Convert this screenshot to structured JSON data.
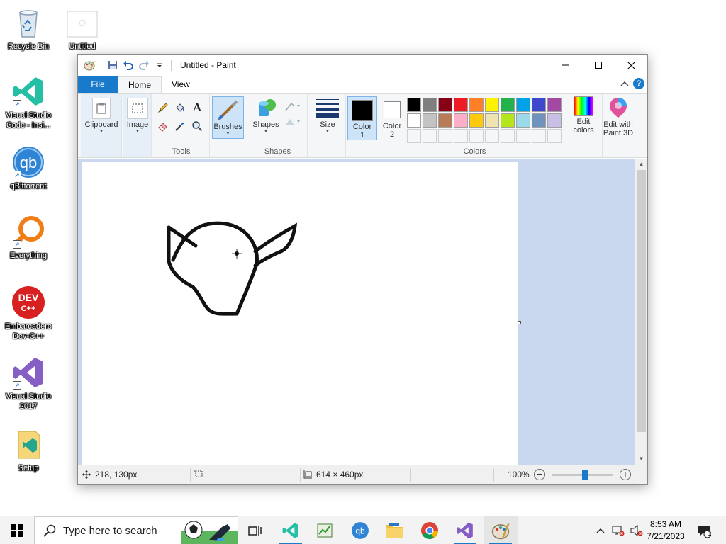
{
  "desktop": {
    "icons": [
      {
        "label": "Recycle Bin",
        "icon": "recycle-bin-icon"
      },
      {
        "label": "Untitled",
        "icon": "paint-file-icon"
      },
      {
        "label": "Visual Studio Code - Insi...",
        "icon": "vscode-insiders-icon"
      },
      {
        "label": "qBittorrent",
        "icon": "qbittorrent-icon"
      },
      {
        "label": "Everything",
        "icon": "everything-search-icon"
      },
      {
        "label": "Embarcadero Dev-C++",
        "icon": "devcpp-icon"
      },
      {
        "label": "Visual Studio 2017",
        "icon": "visual-studio-icon"
      },
      {
        "label": "Setup",
        "icon": "setup-icon"
      }
    ],
    "dev_badge": "DEV\nC++",
    "qb_badge": "qb"
  },
  "window": {
    "title": "Untitled - Paint",
    "tabs": {
      "file": "File",
      "home": "Home",
      "view": "View"
    },
    "help_glyph": "?"
  },
  "ribbon": {
    "clipboard": "Clipboard",
    "image": "Image",
    "tools_group": "Tools",
    "text_tool_glyph": "A",
    "brushes": "Brushes",
    "shapes": "Shapes",
    "shapes_group": "Shapes",
    "size": "Size",
    "color1_line1": "Color",
    "color1_line2": "1",
    "color2_line1": "Color",
    "color2_line2": "2",
    "colors_group": "Colors",
    "edit_colors_line1": "Edit",
    "edit_colors_line2": "colors",
    "paint3d_line1": "Edit with",
    "paint3d_line2": "Paint 3D",
    "palette_row1": [
      "#000000",
      "#7f7f7f",
      "#880015",
      "#ed1c24",
      "#ff7f27",
      "#fff200",
      "#22b14c",
      "#00a2e8",
      "#3f48cc",
      "#a349a4"
    ],
    "palette_row2": [
      "#ffffff",
      "#c3c3c3",
      "#b97a57",
      "#ffaec9",
      "#ffc90e",
      "#efe4b0",
      "#b5e61d",
      "#99d9ea",
      "#7092be",
      "#c8bfe7"
    ],
    "color1_value": "#000000",
    "color2_value": "#ffffff",
    "accent": "#1979ca"
  },
  "status": {
    "cursor_pos": "218, 130px",
    "canvas_size": "614 × 460px",
    "zoom": "100%",
    "zoom_fraction": 0.55
  },
  "taskbar": {
    "search_placeholder": "Type here to search",
    "time": "8:53 AM",
    "date": "7/21/2023",
    "notification_count": "1",
    "qb_label": "qb"
  }
}
